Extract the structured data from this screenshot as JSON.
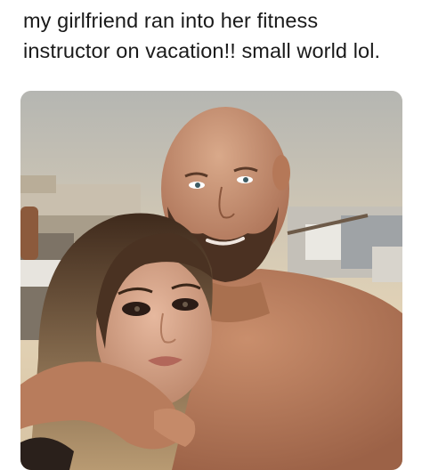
{
  "meme": {
    "caption_line1": "my girlfriend ran into her fitness",
    "caption_line2": "instructor on vacation!! small world lol."
  },
  "photo": {
    "description_icon": "photo-selfie-couple",
    "colors": {
      "sky_top": "#b9b8b0",
      "sky_bottom": "#e8d7b8",
      "skin_man": "#b67a5c",
      "skin_woman": "#d9a98e",
      "hair_woman": "#6b4a32",
      "beard": "#4a3022"
    }
  }
}
